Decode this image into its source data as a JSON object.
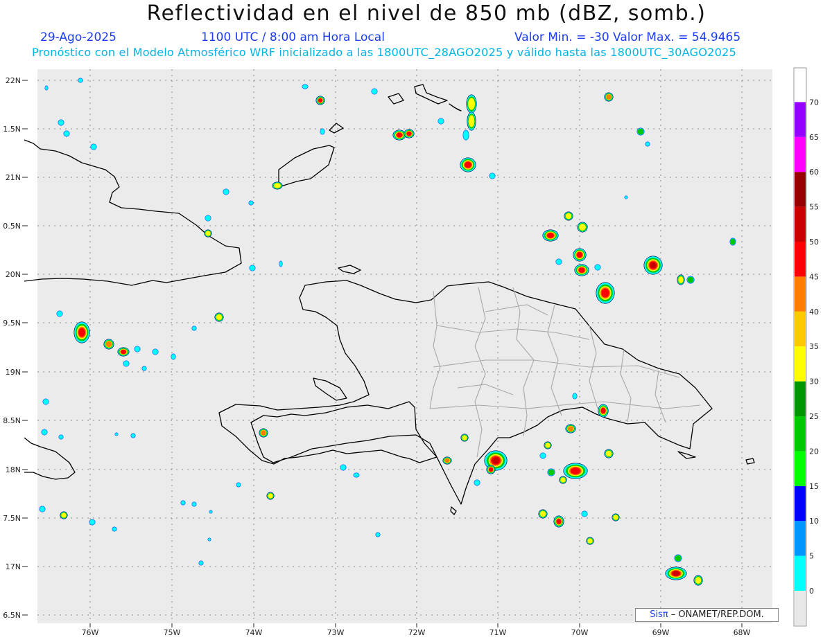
{
  "header": {
    "title": "Reflectividad en el nivel de 850 mb (dBZ, somb.)",
    "date": "29-Ago-2025",
    "time": "1100 UTC / 8:00 am Hora Local",
    "minmax": "Valor Min. = -30  Valor Max. = 54.9465",
    "forecast": "Pronóstico con el Modelo Atmosférico WRF inicializado a las 1800UTC_28AGO2025 y válido hasta las  1800UTC_30AGO2025"
  },
  "map": {
    "lon_range": [
      -76.65,
      -67.65
    ],
    "lat_range": [
      16.45,
      22.1
    ],
    "lat_labels": [
      "22N",
      "1.5N",
      "21N",
      "0.5N",
      "20N",
      "9.5N",
      "19N",
      "8.5N",
      "18N",
      "7.5N",
      "17N",
      "6.5N"
    ],
    "lon_labels": [
      "76W",
      "75W",
      "74W",
      "73W",
      "72W",
      "71W",
      "70W",
      "69W",
      "68W"
    ],
    "colors": {
      "background": "#ebebeb",
      "coast": "#000000",
      "provinces": "#a8a8a8",
      "grid": "#888888"
    }
  },
  "colorbar": {
    "labels": [
      "0",
      "5",
      "10",
      "15",
      "20",
      "25",
      "30",
      "35",
      "40",
      "45",
      "50",
      "55",
      "60",
      "65",
      "70"
    ],
    "colors": [
      "#00ffff",
      "#0096ff",
      "#0000ff",
      "#00ff00",
      "#00c800",
      "#009600",
      "#ffff00",
      "#ffc800",
      "#ff7d00",
      "#ff0000",
      "#c80000",
      "#960000",
      "#ff00ff",
      "#9600ff"
    ]
  },
  "credit": {
    "sis": "Sisπ",
    "rest": " – ONAMET/REP.DOM."
  }
}
